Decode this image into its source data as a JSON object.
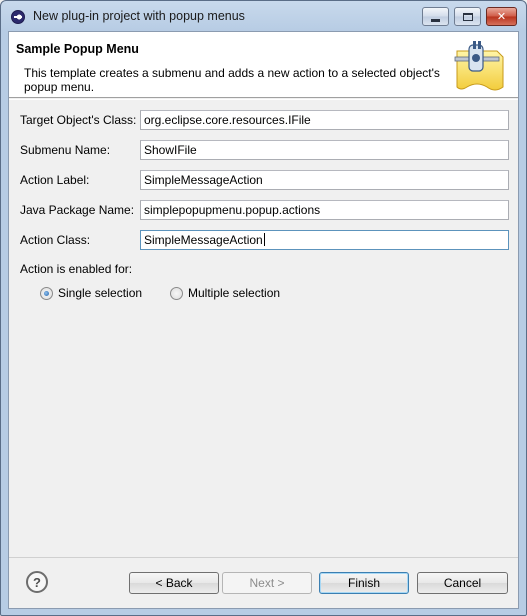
{
  "window": {
    "title": "New plug-in project with popup menus"
  },
  "banner": {
    "title": "Sample Popup Menu",
    "description": "This template creates a submenu and adds a new action to a selected object's popup menu."
  },
  "form": {
    "fields": [
      {
        "label": "Target Object's Class:",
        "value": "org.eclipse.core.resources.IFile"
      },
      {
        "label": "Submenu Name:",
        "value": "ShowIFile"
      },
      {
        "label": "Action Label:",
        "value": "SimpleMessageAction"
      },
      {
        "label": "Java Package Name:",
        "value": "simplepopupmenu.popup.actions"
      },
      {
        "label": "Action Class:",
        "value": "SimpleMessageAction"
      }
    ],
    "enabled_for_label": "Action is enabled for:",
    "options": [
      {
        "label": "Single selection",
        "selected": true
      },
      {
        "label": "Multiple selection",
        "selected": false
      }
    ]
  },
  "buttons": {
    "help": "?",
    "back": "< Back",
    "next": "Next >",
    "finish": "Finish",
    "cancel": "Cancel"
  },
  "icons": {
    "app": "eclipse-icon",
    "banner": "plug-document-icon",
    "help": "help-icon"
  },
  "colors": {
    "title_bar": "#b7cce4",
    "dialog_bg": "#f0f0f0",
    "banner_bg": "#ffffff",
    "focus_border": "#5c93bc"
  }
}
